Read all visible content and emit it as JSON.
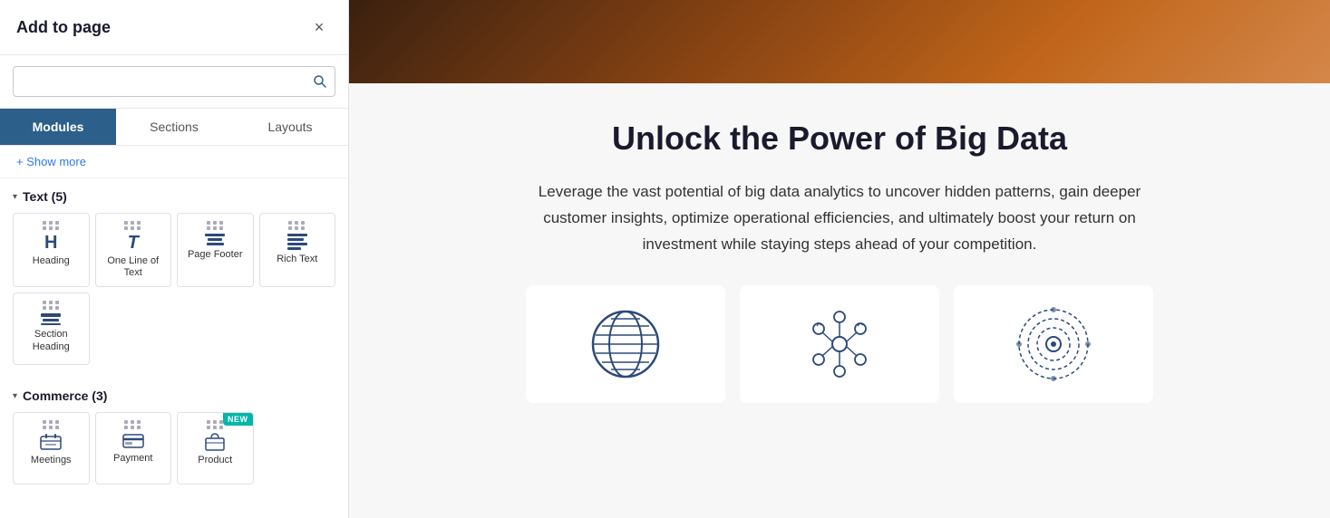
{
  "panel": {
    "title": "Add to page",
    "close_label": "×",
    "search_placeholder": "",
    "tabs": [
      {
        "label": "Modules",
        "active": true
      },
      {
        "label": "Sections",
        "active": false
      },
      {
        "label": "Layouts",
        "active": false
      }
    ],
    "show_more": "+ Show more",
    "groups": [
      {
        "name": "Text (5)",
        "modules": [
          {
            "id": "heading",
            "label": "Heading",
            "symbol_type": "letter_h",
            "is_new": false
          },
          {
            "id": "one-line-text",
            "label": "One Line of Text",
            "symbol_type": "letter_t",
            "is_new": false
          },
          {
            "id": "page-footer",
            "label": "Page Footer",
            "symbol_type": "lines_center",
            "is_new": false
          },
          {
            "id": "rich-text",
            "label": "Rich Text",
            "symbol_type": "lines_left",
            "is_new": false
          },
          {
            "id": "section-heading",
            "label": "Section Heading",
            "symbol_type": "lines_stacked",
            "is_new": false
          }
        ]
      },
      {
        "name": "Commerce (3)",
        "modules": [
          {
            "id": "meetings",
            "label": "Meetings",
            "symbol_type": "meetings",
            "is_new": false
          },
          {
            "id": "payment",
            "label": "Payment",
            "symbol_type": "payment",
            "is_new": false
          },
          {
            "id": "product",
            "label": "Product",
            "symbol_type": "product",
            "is_new": true
          }
        ]
      }
    ]
  },
  "main": {
    "heading": "Unlock the Power of Big Data",
    "body_text": "Leverage the vast potential of big data analytics to uncover hidden patterns, gain deeper customer insights, optimize operational efficiencies, and ultimately boost your return on investment while staying steps ahead of your competition."
  },
  "icons": {
    "search": "🔍",
    "chevron_down": "▾"
  }
}
